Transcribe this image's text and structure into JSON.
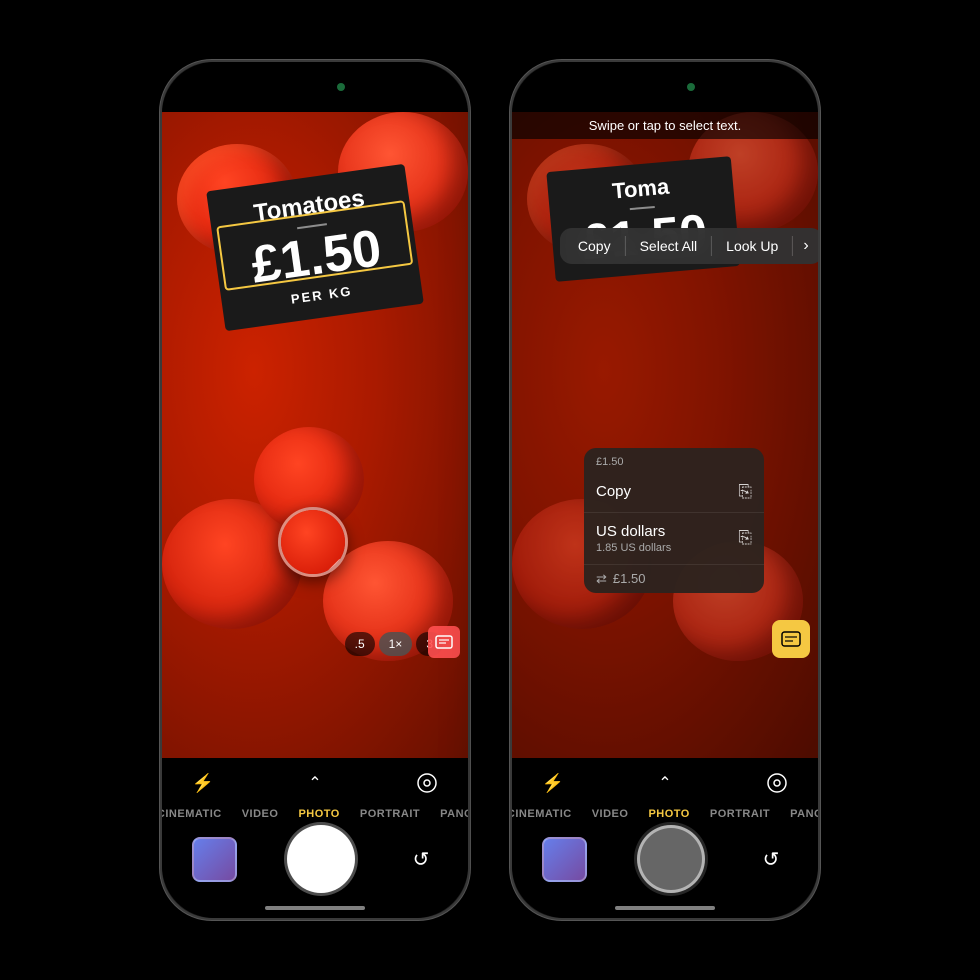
{
  "phone1": {
    "sign": {
      "title": "Tomatoes",
      "price": "£1.50",
      "unit": "PER KG"
    },
    "controls": {
      "flash": "⚡",
      "chevron": "⌃",
      "settings": "◎",
      "rotate": "↺"
    },
    "modes": [
      "CINEMATIC",
      "VIDEO",
      "PHOTO",
      "PORTRAIT",
      "PANO"
    ],
    "active_mode": "PHOTO",
    "zoom": [
      ".5",
      "1×",
      "3"
    ]
  },
  "phone2": {
    "swipe_hint": "Swipe or tap to select text.",
    "sign": {
      "title": "Toma",
      "price": "£1.50"
    },
    "context_menu": {
      "copy": "Copy",
      "select_all": "Select All",
      "look_up": "Look Up",
      "more": "›"
    },
    "dropdown": {
      "header": "£1.50",
      "copy_label": "Copy",
      "usd_label": "US dollars",
      "usd_sub": "1.85 US dollars",
      "currency_symbol": "⇄",
      "currency_price": "£1.50"
    },
    "controls": {
      "flash": "⚡",
      "chevron": "⌃",
      "settings": "◎",
      "rotate": "↺"
    },
    "modes": [
      "CINEMATIC",
      "VIDEO",
      "PHOTO",
      "PORTRAIT",
      "PANO"
    ],
    "active_mode": "PHOTO"
  }
}
